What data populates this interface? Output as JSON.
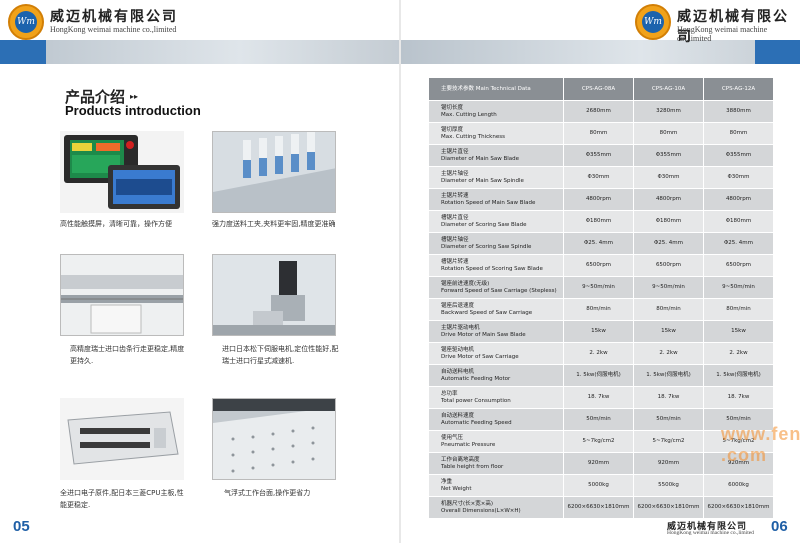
{
  "brand": {
    "cn": "威迈机械有限公司",
    "en": "HongKong weimai machine co.,limited",
    "logo_text": "Wm"
  },
  "left_page": {
    "title_cn": "产品介绍",
    "title_arrows": "▸▸",
    "title_en": "Products introduction",
    "page_number": "05",
    "captions": [
      "高性能触摸屏，清晰可靠，操作方便",
      "强力度送料工夹,夹料更牢固,精度更准确",
      "高精度瑞士进口齿条行走更稳定,精度更持久.",
      "进口日本松下伺服电机,定位性能好,配瑞士进口行星式减速机.",
      "全进口电子原件,配日本三菱CPU主板,性能更稳定.",
      "气浮式工作台面,操作更省力"
    ]
  },
  "right_page": {
    "page_number": "06",
    "footer_cn": "威迈机械有限公司",
    "footer_en": "HongKong weimai machine co.,limited",
    "watermark": "www.fengj .com",
    "table": {
      "header": [
        "主要技术参数 Main Technical Data",
        "CPS-AG-08A",
        "CPS-AG-10A",
        "CPS-AG-12A"
      ],
      "rows": [
        {
          "cn": "锯切长度",
          "en": "Max. Cutting Length",
          "v": [
            "2680mm",
            "3280mm",
            "3880mm"
          ]
        },
        {
          "cn": "锯切厚度",
          "en": "Max. Cutting Thickness",
          "v": [
            "80mm",
            "80mm",
            "80mm"
          ]
        },
        {
          "cn": "主锯片直径",
          "en": "Diameter of Main Saw Blade",
          "v": [
            "Φ355mm",
            "Φ355mm",
            "Φ355mm"
          ]
        },
        {
          "cn": "主锯片轴径",
          "en": "Diameter of Main Saw Spindle",
          "v": [
            "Φ30mm",
            "Φ30mm",
            "Φ30mm"
          ]
        },
        {
          "cn": "主锯片转速",
          "en": "Rotation Speed of Main Saw Blade",
          "v": [
            "4800rpm",
            "4800rpm",
            "4800rpm"
          ]
        },
        {
          "cn": "槽锯片直径",
          "en": "Diameter of Scoring Saw Blade",
          "v": [
            "Φ180mm",
            "Φ180mm",
            "Φ180mm"
          ]
        },
        {
          "cn": "槽锯片轴径",
          "en": "Diameter of Scoring Saw Spindle",
          "v": [
            "Φ25. 4mm",
            "Φ25. 4mm",
            "Φ25. 4mm"
          ]
        },
        {
          "cn": "槽锯片转速",
          "en": "Rotation Speed of Scoring Saw Blade",
          "v": [
            "6500rpm",
            "6500rpm",
            "6500rpm"
          ]
        },
        {
          "cn": "锯座前进速度(无级)",
          "en": "Forward Speed of Saw Carriage (Stepless)",
          "v": [
            "9~50m/min",
            "9~50m/min",
            "9~50m/min"
          ]
        },
        {
          "cn": "锯座后退速度",
          "en": "Backward Speed of Saw Carriage",
          "v": [
            "80m/min",
            "80m/min",
            "80m/min"
          ]
        },
        {
          "cn": "主锯片驱动电机",
          "en": "Drive Motor of Main Saw Blade",
          "v": [
            "15kw",
            "15kw",
            "15kw"
          ]
        },
        {
          "cn": "锯座驱动电机",
          "en": "Drive Motor of Saw Carriage",
          "v": [
            "2. 2kw",
            "2. 2kw",
            "2. 2kw"
          ]
        },
        {
          "cn": "自动送料电机",
          "en": "Automatic Feeding Motor",
          "v": [
            "1. 5kw(伺服电机)",
            "1. 5kw(伺服电机)",
            "1. 5kw(伺服电机)"
          ]
        },
        {
          "cn": "总功率",
          "en": "Total power Consumption",
          "v": [
            "18. 7kw",
            "18. 7kw",
            "18. 7kw"
          ]
        },
        {
          "cn": "自动送料速度",
          "en": "Automatic Feeding Speed",
          "v": [
            "50m/min",
            "50m/min",
            "50m/min"
          ]
        },
        {
          "cn": "使用气压",
          "en": "Pneumatic Pressure",
          "v": [
            "5~7kg/cm2",
            "5~7kg/cm2",
            "5~7kg/cm2"
          ]
        },
        {
          "cn": "工作台离地高度",
          "en": "Table height from floor",
          "v": [
            "920mm",
            "920mm",
            "920mm"
          ]
        },
        {
          "cn": "净重",
          "en": "Net Weight",
          "v": [
            "5000kg",
            "5500kg",
            "6000kg"
          ]
        },
        {
          "cn": "机器尺寸(长×宽×高)",
          "en": "Overall Dimensions(L×W×H)",
          "v": [
            "6200×6630×1810mm",
            "6200×6630×1810mm",
            "6200×6630×1810mm"
          ]
        }
      ]
    }
  },
  "colors": {
    "accent_blue": "#2c6fb5",
    "logo_orange": "#f1a21a",
    "table_header": "#8a8f94",
    "watermark": "#f28c28"
  }
}
